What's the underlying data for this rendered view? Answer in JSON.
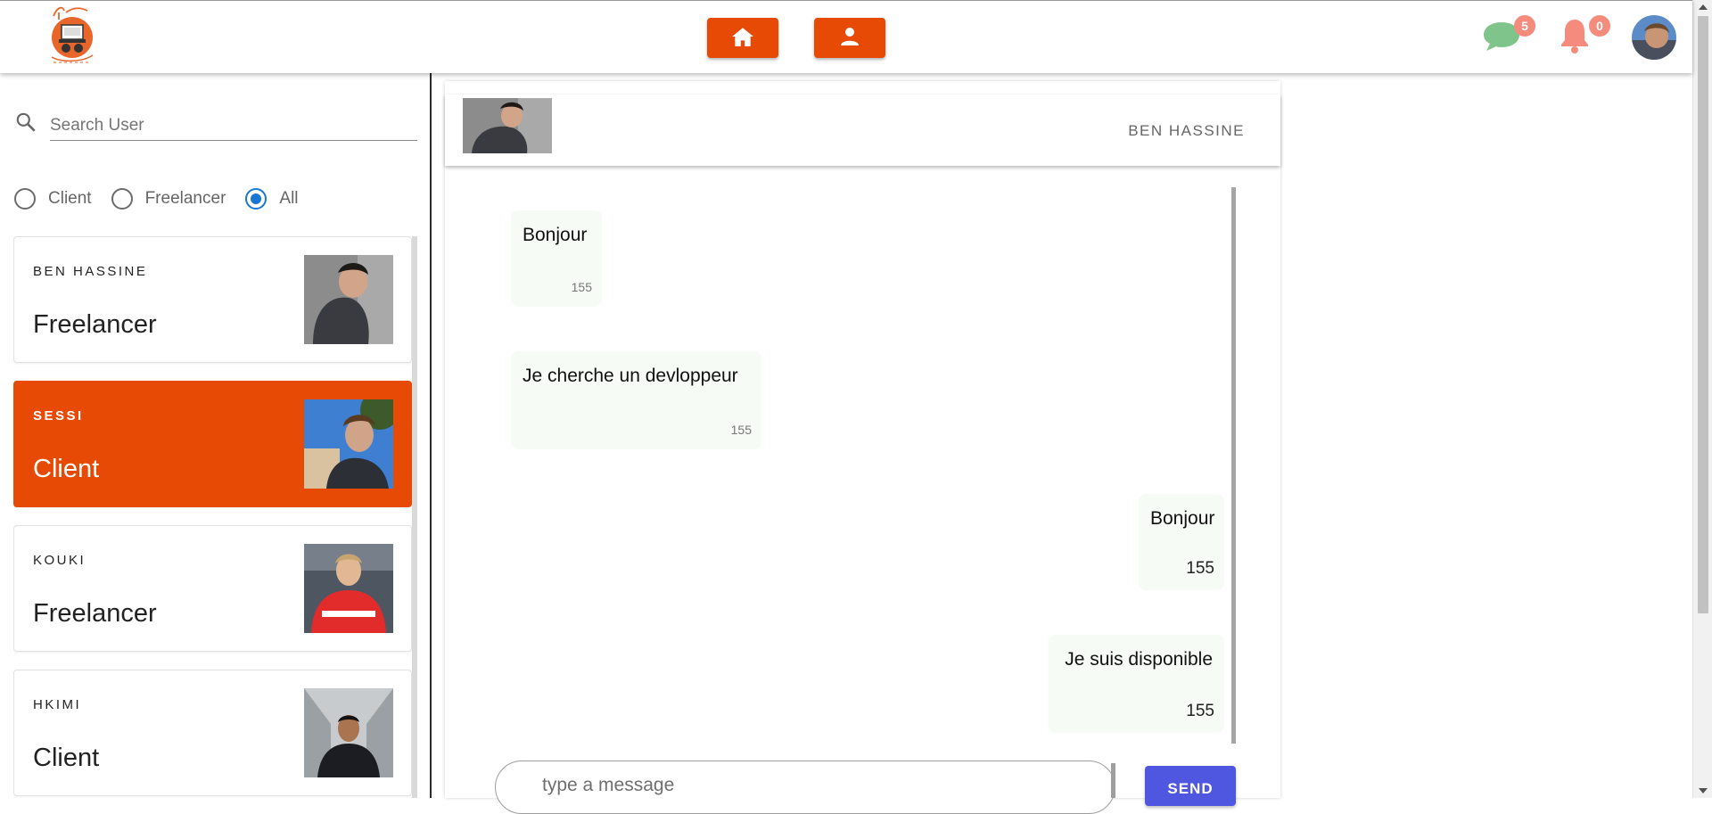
{
  "header": {
    "home_icon": "home-icon",
    "profile_icon": "person-icon",
    "messages_badge": "5",
    "notifications_badge": "0",
    "accent_color": "#e64a04"
  },
  "sidebar": {
    "search": {
      "placeholder": "Search User",
      "value": ""
    },
    "filters": [
      {
        "label": "Client",
        "checked": false
      },
      {
        "label": "Freelancer",
        "checked": false
      },
      {
        "label": "All",
        "checked": true
      }
    ],
    "users": [
      {
        "name": "BEN HASSINE",
        "role": "Freelancer",
        "active": false
      },
      {
        "name": "SESSI",
        "role": "Client",
        "active": true
      },
      {
        "name": "KOUKI",
        "role": "Freelancer",
        "active": false
      },
      {
        "name": "HKIMI",
        "role": "Client",
        "active": false
      }
    ]
  },
  "chat": {
    "contact_name": "BEN HASSINE",
    "messages": [
      {
        "text": "Bonjour",
        "time": "155",
        "side": "left"
      },
      {
        "text": "Je cherche un devloppeur",
        "time": "155",
        "side": "left"
      },
      {
        "text": "Bonjour",
        "time": "155",
        "side": "right"
      },
      {
        "text": "Je suis disponible",
        "time": "155",
        "side": "right"
      }
    ],
    "composer": {
      "placeholder": "type a message",
      "value": ""
    },
    "send_label": "SEND"
  }
}
